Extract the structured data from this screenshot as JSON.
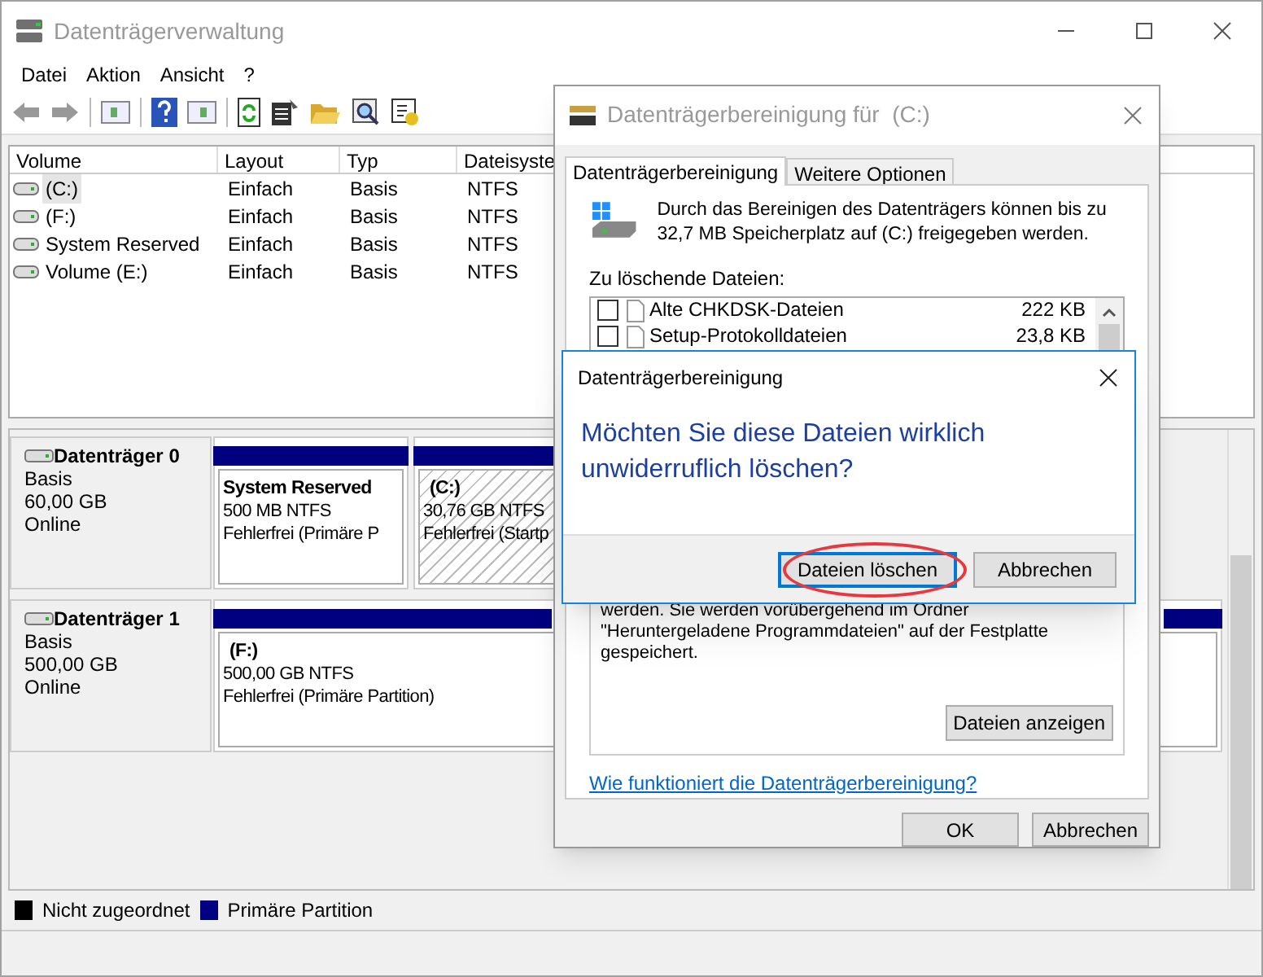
{
  "window": {
    "title": "Datenträgerverwaltung"
  },
  "menu": [
    "Datei",
    "Aktion",
    "Ansicht",
    "?"
  ],
  "volume_table": {
    "columns": [
      "Volume",
      "Layout",
      "Typ",
      "Dateisyste"
    ],
    "rows": [
      {
        "cells": [
          "(C:)",
          "Einfach",
          "Basis",
          "NTFS"
        ],
        "selected": true
      },
      {
        "cells": [
          "(F:)",
          "Einfach",
          "Basis",
          "NTFS"
        ],
        "selected": false
      },
      {
        "cells": [
          "System Reserved",
          "Einfach",
          "Basis",
          "NTFS"
        ],
        "selected": false
      },
      {
        "cells": [
          "Volume (E:)",
          "Einfach",
          "Basis",
          "NTFS"
        ],
        "selected": false
      }
    ]
  },
  "disks": [
    {
      "name": "Datenträger 0",
      "type": "Basis",
      "size": "60,00 GB",
      "status": "Online",
      "partitions": [
        {
          "name": "System Reserved",
          "size": "500 MB NTFS",
          "status": "Fehlerfrei (Primäre P",
          "selected": false
        },
        {
          "name": "(C:)",
          "size": "30,76 GB NTFS",
          "status": "Fehlerfrei (Startp",
          "selected": true
        }
      ]
    },
    {
      "name": "Datenträger 1",
      "type": "Basis",
      "size": "500,00 GB",
      "status": "Online",
      "partitions": [
        {
          "name": "(F:)",
          "size": "500,00 GB NTFS",
          "status": "Fehlerfrei (Primäre Partition)",
          "selected": false
        }
      ]
    }
  ],
  "legend": [
    {
      "label": "Nicht zugeordnet",
      "color": "#000000"
    },
    {
      "label": "Primäre Partition",
      "color": "#000080"
    }
  ],
  "cleanup_dialog": {
    "title": "Datenträgerbereinigung für  (C:)",
    "tabs": [
      {
        "label": "Datenträgerbereinigung",
        "selected": true
      },
      {
        "label": "Weitere Optionen",
        "selected": false
      }
    ],
    "summary": "Durch das Bereinigen des Datenträgers können bis zu 32,7 MB Speicherplatz auf  (C:) freigegeben werden.",
    "files_label": "Zu löschende Dateien:",
    "files": [
      {
        "name": "Alte CHKDSK-Dateien",
        "size": "222 KB",
        "checked": false
      },
      {
        "name": "Setup-Protokolldateien",
        "size": "23,8 KB",
        "checked": false
      }
    ],
    "description": "werden. Sie werden vorübergehend im Ordner \"Heruntergeladene Programmdateien\" auf der Festplatte gespeichert.",
    "view_files_button": "Dateien anzeigen",
    "help_link": "Wie funktioniert die Datenträgerbereinigung?",
    "buttons": [
      "OK",
      "Abbrechen"
    ]
  },
  "confirm_dialog": {
    "title": "Datenträgerbereinigung",
    "message": "Möchten Sie diese Dateien wirklich unwiderruflich löschen?",
    "buttons": [
      {
        "label": "Dateien löschen",
        "default": true,
        "circled": true
      },
      {
        "label": "Abbrechen",
        "default": false,
        "circled": false
      }
    ]
  }
}
